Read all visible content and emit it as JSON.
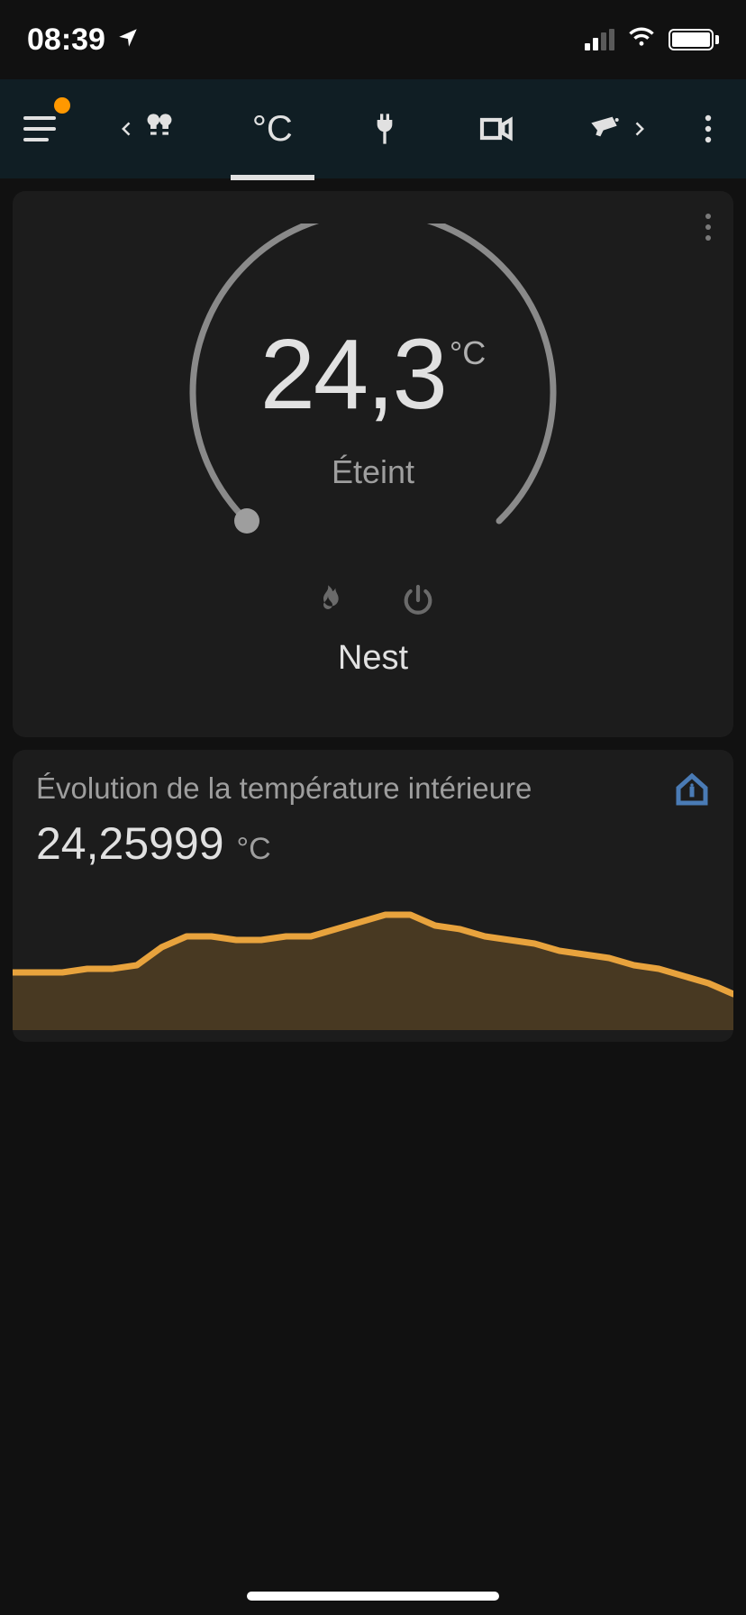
{
  "status": {
    "time": "08:39"
  },
  "nav": {
    "active_tab_label": "°C"
  },
  "thermostat": {
    "temperature": "24,3",
    "unit": "°C",
    "state": "Éteint",
    "name": "Nest"
  },
  "history": {
    "title": "Évolution de la température intérieure",
    "value": "24,25999",
    "unit": "°C"
  },
  "chart_data": {
    "type": "area",
    "title": "Évolution de la température intérieure",
    "ylabel": "°C",
    "ylim": [
      22,
      26
    ],
    "accent_color": "#e8a33d",
    "x": [
      0,
      1,
      2,
      3,
      4,
      5,
      6,
      7,
      8,
      9,
      10,
      11,
      12,
      13,
      14,
      15,
      16,
      17,
      18,
      19,
      20,
      21,
      22,
      23,
      24,
      25,
      26,
      27,
      28,
      29
    ],
    "values": [
      23.6,
      23.6,
      23.6,
      23.7,
      23.7,
      23.8,
      24.3,
      24.6,
      24.6,
      24.5,
      24.5,
      24.6,
      24.6,
      24.8,
      25.0,
      25.2,
      25.2,
      24.9,
      24.8,
      24.6,
      24.5,
      24.4,
      24.2,
      24.1,
      24.0,
      23.8,
      23.7,
      23.5,
      23.3,
      23.0
    ]
  }
}
